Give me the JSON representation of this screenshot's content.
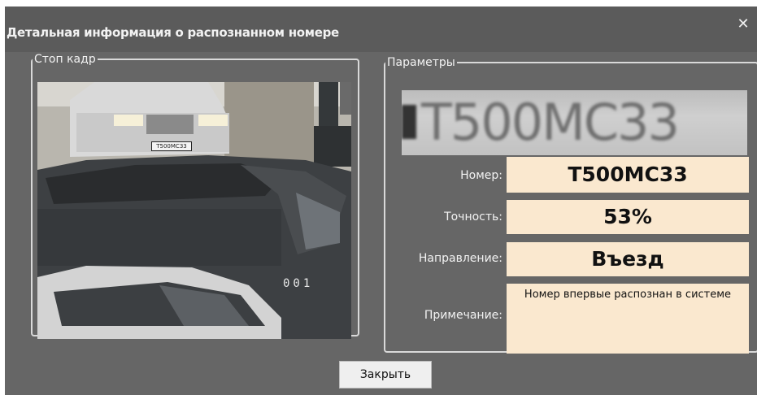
{
  "dialog": {
    "title": "Детальная информация о распознанном номере",
    "close_icon": "close-icon",
    "close_glyph": "✕"
  },
  "left_group": {
    "legend": "Стоп кадр",
    "camera_number": "001",
    "car_plate_text": "T500MC33"
  },
  "right_group": {
    "legend": "Параметры",
    "plate_image_text": "T500MC33",
    "fields": {
      "number": {
        "label": "Номер:",
        "value": "T500MC33"
      },
      "accuracy": {
        "label": "Точность:",
        "value": "53%"
      },
      "direction": {
        "label": "Направление:",
        "value": "Въезд"
      },
      "note": {
        "label": "Примечание:",
        "value": "Номер впервые распознан в системе"
      }
    }
  },
  "buttons": {
    "close_label": "Закрыть"
  },
  "colors": {
    "dialog_bg": "#666666",
    "titlebar_bg": "#5b5b5b",
    "value_bg": "#fae8cf",
    "text_light": "#f2f2f2"
  }
}
